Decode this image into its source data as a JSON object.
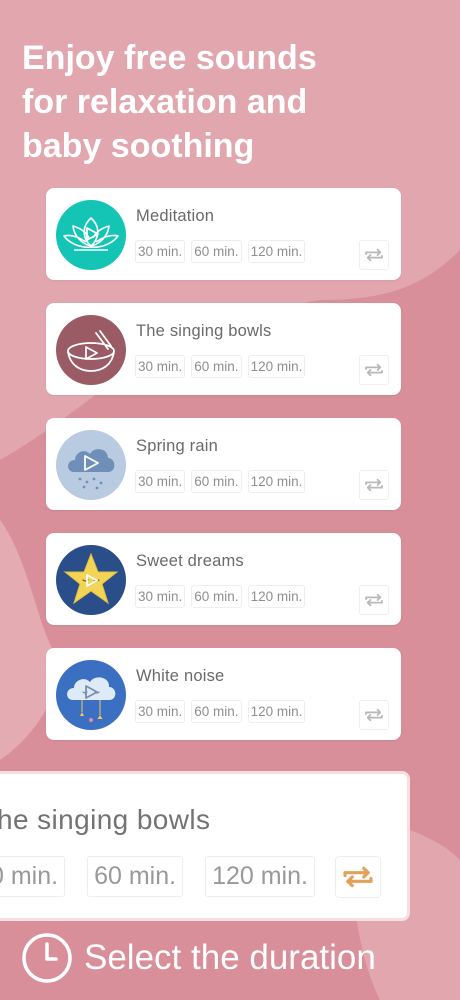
{
  "colors": {
    "background": "#d98f99",
    "card": "#ffffff",
    "accent_repeat": "#e2a15a",
    "chip_text": "#8f8f8f"
  },
  "headline": {
    "line1": "Enjoy free sounds",
    "line2": "for relaxation and",
    "line3": "baby soothing"
  },
  "sounds": [
    {
      "title": "Meditation",
      "icon": "lotus-icon",
      "thumb_color": "#14c4b5",
      "durations": [
        "30 min.",
        "60 min.",
        "120 min."
      ]
    },
    {
      "title": "The singing bowls",
      "icon": "singing-bowl-icon",
      "thumb_color": "#9a5b64",
      "durations": [
        "30 min.",
        "60 min.",
        "120 min."
      ]
    },
    {
      "title": "Spring rain",
      "icon": "rain-cloud-icon",
      "thumb_color": "#b9cbe0",
      "durations": [
        "30 min.",
        "60 min.",
        "120 min."
      ]
    },
    {
      "title": "Sweet dreams",
      "icon": "sleeping-star-icon",
      "thumb_color": "#2a4e8a",
      "durations": [
        "30 min.",
        "60 min.",
        "120 min."
      ]
    },
    {
      "title": "White noise",
      "icon": "sleeping-cloud-icon",
      "thumb_color": "#3a6fc2",
      "durations": [
        "30 min.",
        "60 min.",
        "120 min."
      ]
    }
  ],
  "detail_panel": {
    "title": "he singing bowls",
    "durations": [
      "0 min.",
      "60 min.",
      "120 min."
    ]
  },
  "footer": {
    "text": "Select the duration",
    "icon": "clock-icon"
  }
}
